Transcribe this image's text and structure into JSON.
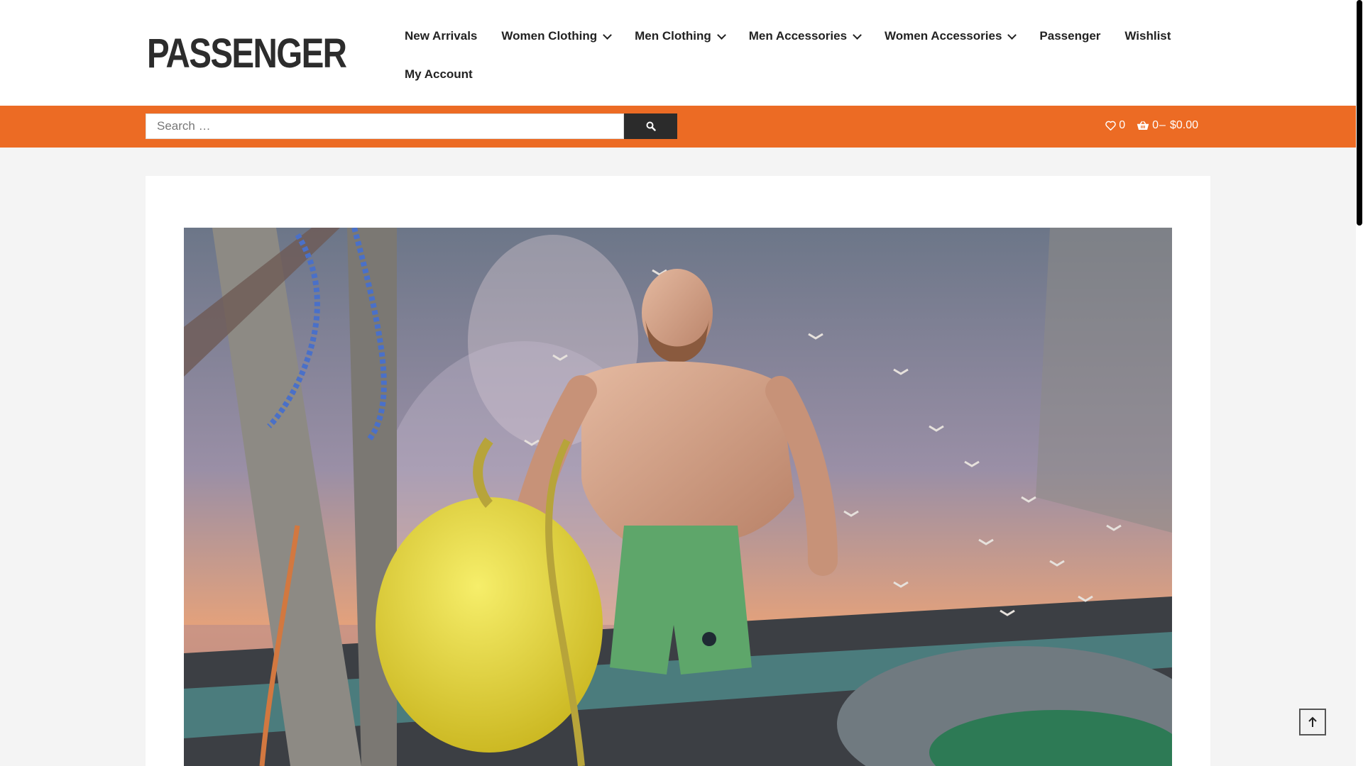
{
  "brand": {
    "name": "PASSENGER"
  },
  "nav": {
    "items": [
      {
        "label": "New Arrivals",
        "has_dropdown": false
      },
      {
        "label": "Women Clothing",
        "has_dropdown": true
      },
      {
        "label": "Men Clothing",
        "has_dropdown": true
      },
      {
        "label": "Men Accessories",
        "has_dropdown": true
      },
      {
        "label": "Women Accessories",
        "has_dropdown": true
      },
      {
        "label": "Passenger",
        "has_dropdown": false
      },
      {
        "label": "Wishlist",
        "has_dropdown": false
      }
    ],
    "second_row": [
      {
        "label": "My Account",
        "has_dropdown": false
      }
    ]
  },
  "search": {
    "placeholder": "Search …",
    "icon": "search-icon"
  },
  "header_tools": {
    "wishlist_count": "0",
    "wishlist_icon": "heart-icon",
    "cart_count": "0",
    "cart_separator": "–",
    "cart_total": "$0.00",
    "cart_icon": "basket-icon"
  },
  "hero": {
    "description_icon": "hero-image",
    "colors": {
      "sky_top": "#6f7a8c",
      "sky_bottom": "#e9a073",
      "shorts": "#5fa36a",
      "buoy": "#e5dc3a"
    }
  },
  "back_to_top": {
    "icon": "arrow-up-icon"
  },
  "colors": {
    "accent": "#ec6b24",
    "button_dark": "#2b2b2b",
    "page_bg": "#f4f4f4"
  }
}
